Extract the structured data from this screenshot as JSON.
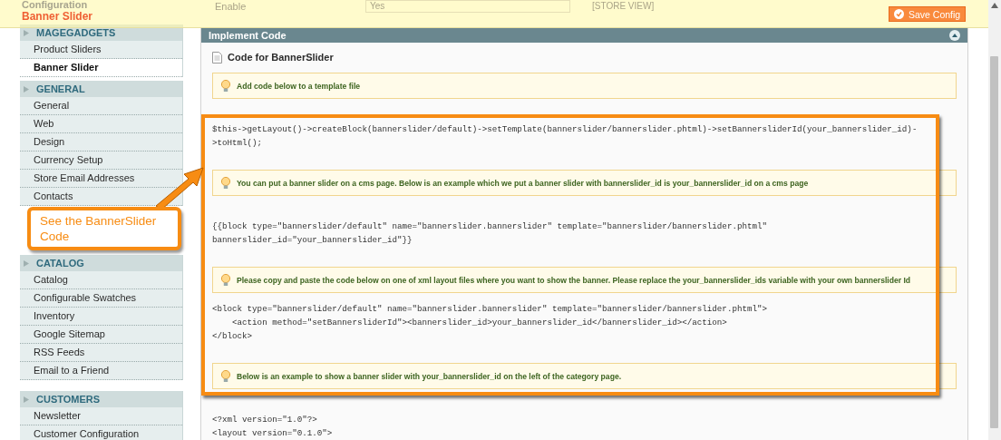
{
  "header": {
    "section": "Configuration",
    "title": "Banner Slider",
    "field_label": "Enable",
    "field_value": "Yes",
    "scope": "[STORE VIEW]",
    "save_button": "Save Config"
  },
  "sidebar": {
    "groups": [
      {
        "title": "MAGEGADGETS",
        "items": [
          {
            "label": "Product Sliders",
            "selected": false
          },
          {
            "label": "Banner Slider",
            "selected": true
          }
        ]
      },
      {
        "title": "GENERAL",
        "items": [
          {
            "label": "General",
            "selected": false
          },
          {
            "label": "Web",
            "selected": false
          },
          {
            "label": "Design",
            "selected": false
          },
          {
            "label": "Currency Setup",
            "selected": false
          },
          {
            "label": "Store Email Addresses",
            "selected": false
          },
          {
            "label": "Contacts",
            "selected": false
          }
        ]
      },
      {
        "title": "CATALOG",
        "items": [
          {
            "label": "Catalog",
            "selected": false
          },
          {
            "label": "Configurable Swatches",
            "selected": false
          },
          {
            "label": "Inventory",
            "selected": false
          },
          {
            "label": "Google Sitemap",
            "selected": false
          },
          {
            "label": "RSS Feeds",
            "selected": false
          },
          {
            "label": "Email to a Friend",
            "selected": false
          }
        ]
      },
      {
        "title": "CUSTOMERS",
        "items": [
          {
            "label": "Newsletter",
            "selected": false
          },
          {
            "label": "Customer Configuration",
            "selected": false
          }
        ]
      }
    ]
  },
  "panel": {
    "title": "Implement Code",
    "subtitle": "Code for BannerSlider",
    "blocks": [
      {
        "kind": "notice",
        "text": "Add code below to a template file"
      },
      {
        "kind": "code",
        "lines": [
          "$this->getLayout()->createBlock(bannerslider/default)->setTemplate(bannerslider/bannerslider.phtml)->setBannersliderId(your_bannerslider_id)-",
          ">toHtml();"
        ]
      },
      {
        "kind": "notice",
        "text": "You can put a banner slider on a cms page. Below is an example which we put a banner slider with bannerslider_id is your_bannerslider_id on a cms page"
      },
      {
        "kind": "code",
        "lines": [
          "{{block type=\"bannerslider/default\" name=\"bannerslider.bannerslider\" template=\"bannerslider/bannerslider.phtml\"",
          "bannerslider_id=\"your_bannerslider_id\"}}"
        ]
      },
      {
        "kind": "notice",
        "text": "Please copy and paste the code below on one of xml layout files where you want to show the banner. Please replace the your_bannerslider_ids variable with your own bannerslider Id"
      },
      {
        "kind": "code",
        "lines": [
          "<block type=\"bannerslider/default\" name=\"bannerslider.bannerslider\" template=\"bannerslider/bannerslider.phtml\">",
          "    <action method=\"setBannersliderId\"><bannerslider_id>your_bannerslider_id</bannerslider_id></action>",
          "</block>"
        ]
      },
      {
        "kind": "notice",
        "text": "Below is an example to show a banner slider with your_bannerslider_id on the left of the category page."
      },
      {
        "kind": "code",
        "lines": [
          "<?xml version=\"1.0\"?>",
          "<layout version=\"0.1.0\">"
        ]
      }
    ]
  },
  "callout": {
    "text": "See the BannerSlider Code"
  }
}
